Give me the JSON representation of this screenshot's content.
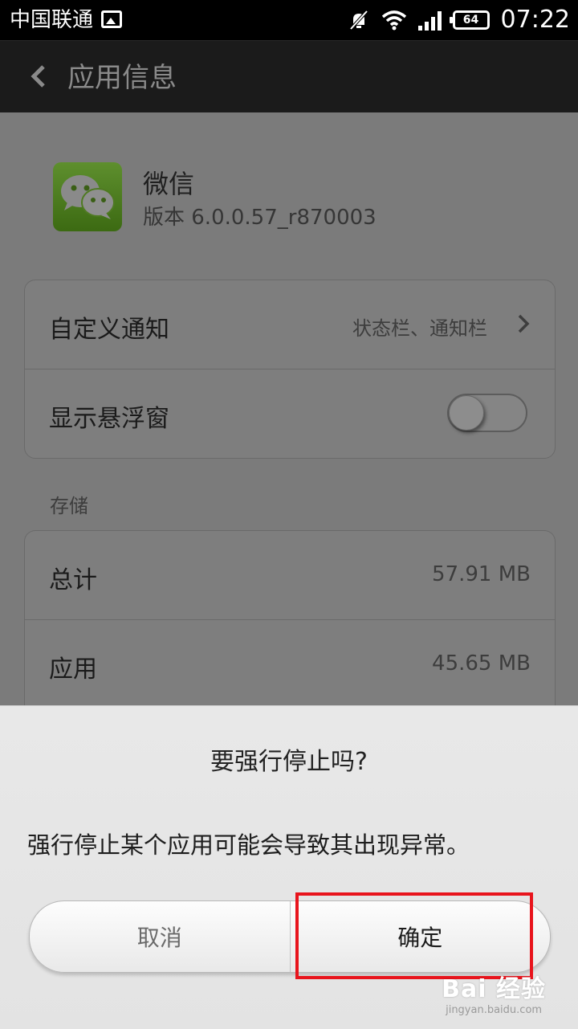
{
  "status_bar": {
    "carrier": "中国联通",
    "battery": "64",
    "time": "07:22"
  },
  "header": {
    "title": "应用信息"
  },
  "app": {
    "name": "微信",
    "version": "版本 6.0.0.57_r870003"
  },
  "settings": {
    "custom_notification": {
      "label": "自定义通知",
      "value": "状态栏、通知栏"
    },
    "floating_window": {
      "label": "显示悬浮窗",
      "enabled": false
    }
  },
  "storage": {
    "section_label": "存储",
    "total": {
      "label": "总计",
      "value": "57.91 MB"
    },
    "app": {
      "label": "应用",
      "value": "45.65 MB"
    }
  },
  "dialog": {
    "title": "要强行停止吗?",
    "message": "强行停止某个应用可能会导致其出现异常。",
    "cancel_label": "取消",
    "ok_label": "确定"
  },
  "watermark": {
    "brand": "Bai 经验",
    "url": "jingyan.baidu.com"
  },
  "colors": {
    "highlight": "#e8141c",
    "header_bg": "#1b1b1b",
    "wechat_green": "#4d7f20"
  }
}
